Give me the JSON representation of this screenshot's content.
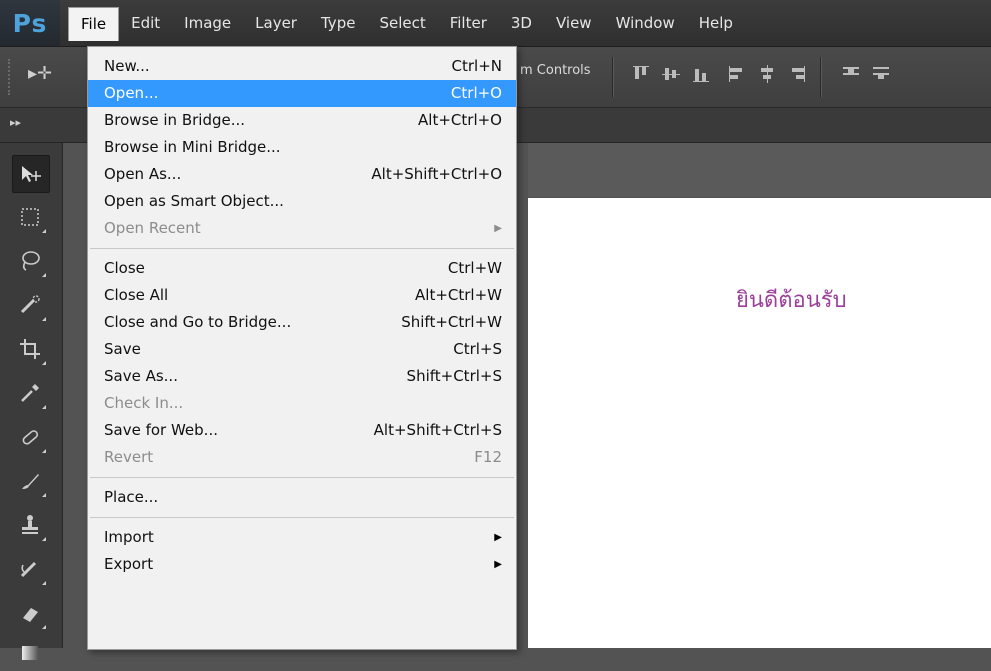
{
  "app": {
    "logo": "Ps"
  },
  "menubar": {
    "items": [
      "File",
      "Edit",
      "Image",
      "Layer",
      "Type",
      "Select",
      "Filter",
      "3D",
      "View",
      "Window",
      "Help"
    ]
  },
  "options_bar": {
    "controls_label": "m Controls"
  },
  "canvas": {
    "text": "ยินดีต้อนรับ",
    "text_color": "#9b3f9b"
  },
  "file_menu": {
    "items": [
      {
        "label": "New...",
        "shortcut": "Ctrl+N"
      },
      {
        "label": "Open...",
        "shortcut": "Ctrl+O"
      },
      {
        "label": "Browse in Bridge...",
        "shortcut": "Alt+Ctrl+O"
      },
      {
        "label": "Browse in Mini Bridge...",
        "shortcut": ""
      },
      {
        "label": "Open As...",
        "shortcut": "Alt+Shift+Ctrl+O"
      },
      {
        "label": "Open as Smart Object...",
        "shortcut": ""
      },
      {
        "label": "Open Recent",
        "shortcut": ""
      },
      {
        "label": "Close",
        "shortcut": "Ctrl+W"
      },
      {
        "label": "Close All",
        "shortcut": "Alt+Ctrl+W"
      },
      {
        "label": "Close and Go to Bridge...",
        "shortcut": "Shift+Ctrl+W"
      },
      {
        "label": "Save",
        "shortcut": "Ctrl+S"
      },
      {
        "label": "Save As...",
        "shortcut": "Shift+Ctrl+S"
      },
      {
        "label": "Check In...",
        "shortcut": ""
      },
      {
        "label": "Save for Web...",
        "shortcut": "Alt+Shift+Ctrl+S"
      },
      {
        "label": "Revert",
        "shortcut": "F12"
      },
      {
        "label": "Place...",
        "shortcut": ""
      },
      {
        "label": "Import",
        "shortcut": ""
      },
      {
        "label": "Export",
        "shortcut": ""
      }
    ]
  },
  "colors": {
    "highlight": "#3399ff",
    "ps_blue": "#4fa3dc"
  }
}
